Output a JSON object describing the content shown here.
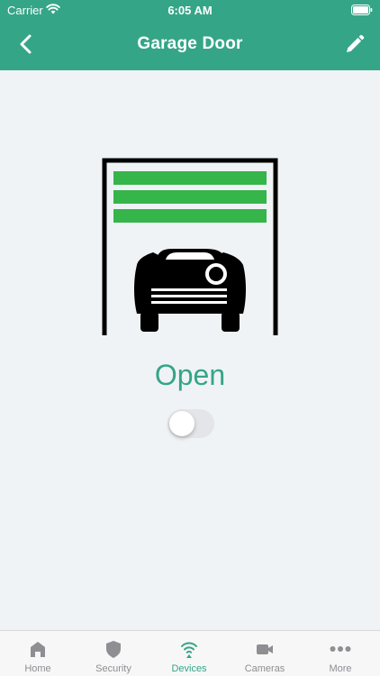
{
  "status_bar": {
    "carrier": "Carrier",
    "time": "6:05 AM"
  },
  "nav": {
    "title": "Garage Door",
    "back_icon": "chevron-left-icon",
    "edit_icon": "pencil-icon"
  },
  "device": {
    "state": "Open",
    "toggle_on": false
  },
  "tabs": [
    {
      "label": "Home",
      "icon": "home-icon",
      "active": false
    },
    {
      "label": "Security",
      "icon": "shield-icon",
      "active": false
    },
    {
      "label": "Devices",
      "icon": "wifi-icon",
      "active": true
    },
    {
      "label": "Cameras",
      "icon": "video-camera-icon",
      "active": false
    },
    {
      "label": "More",
      "icon": "ellipsis-icon",
      "active": false
    }
  ],
  "colors": {
    "accent": "#35a587",
    "door_slats": "#35b54a",
    "background": "#eff3f6",
    "inactive": "#8e8e93"
  }
}
